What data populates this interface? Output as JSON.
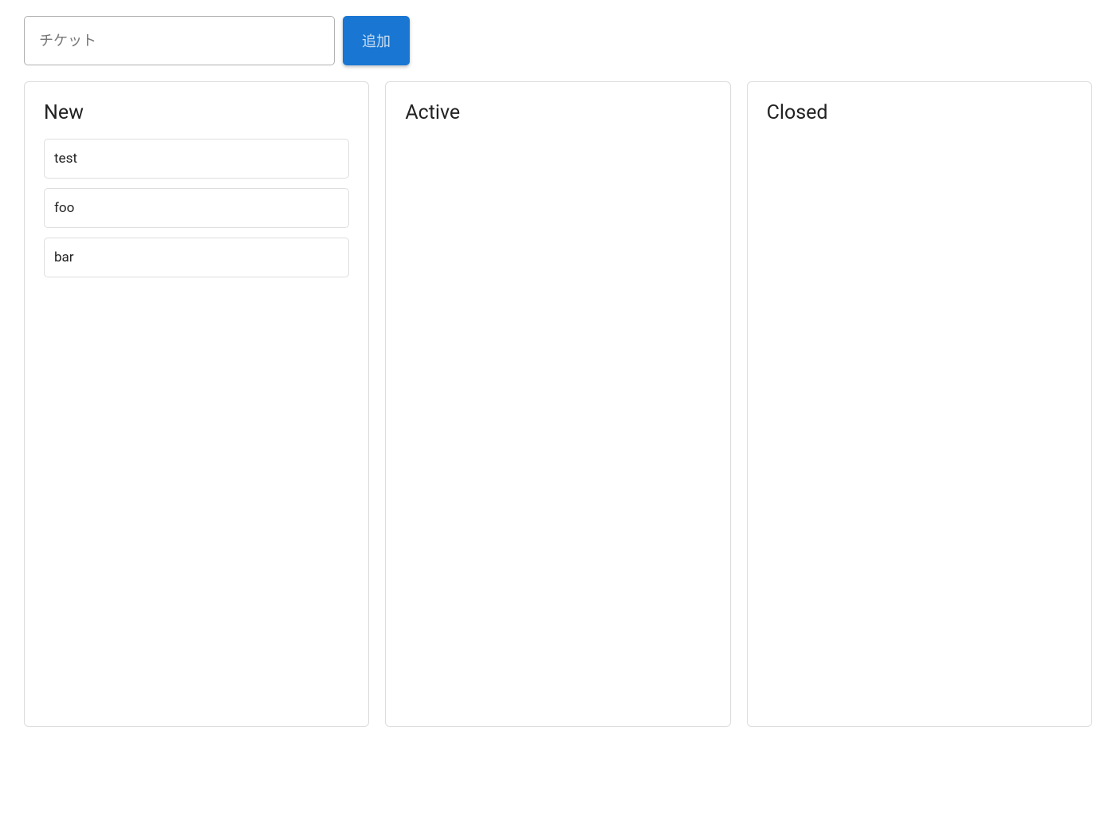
{
  "input": {
    "placeholder": "チケット",
    "value": ""
  },
  "add_button_label": "追加",
  "columns": [
    {
      "title": "New",
      "cards": [
        "test",
        "foo",
        "bar"
      ]
    },
    {
      "title": "Active",
      "cards": []
    },
    {
      "title": "Closed",
      "cards": []
    }
  ]
}
